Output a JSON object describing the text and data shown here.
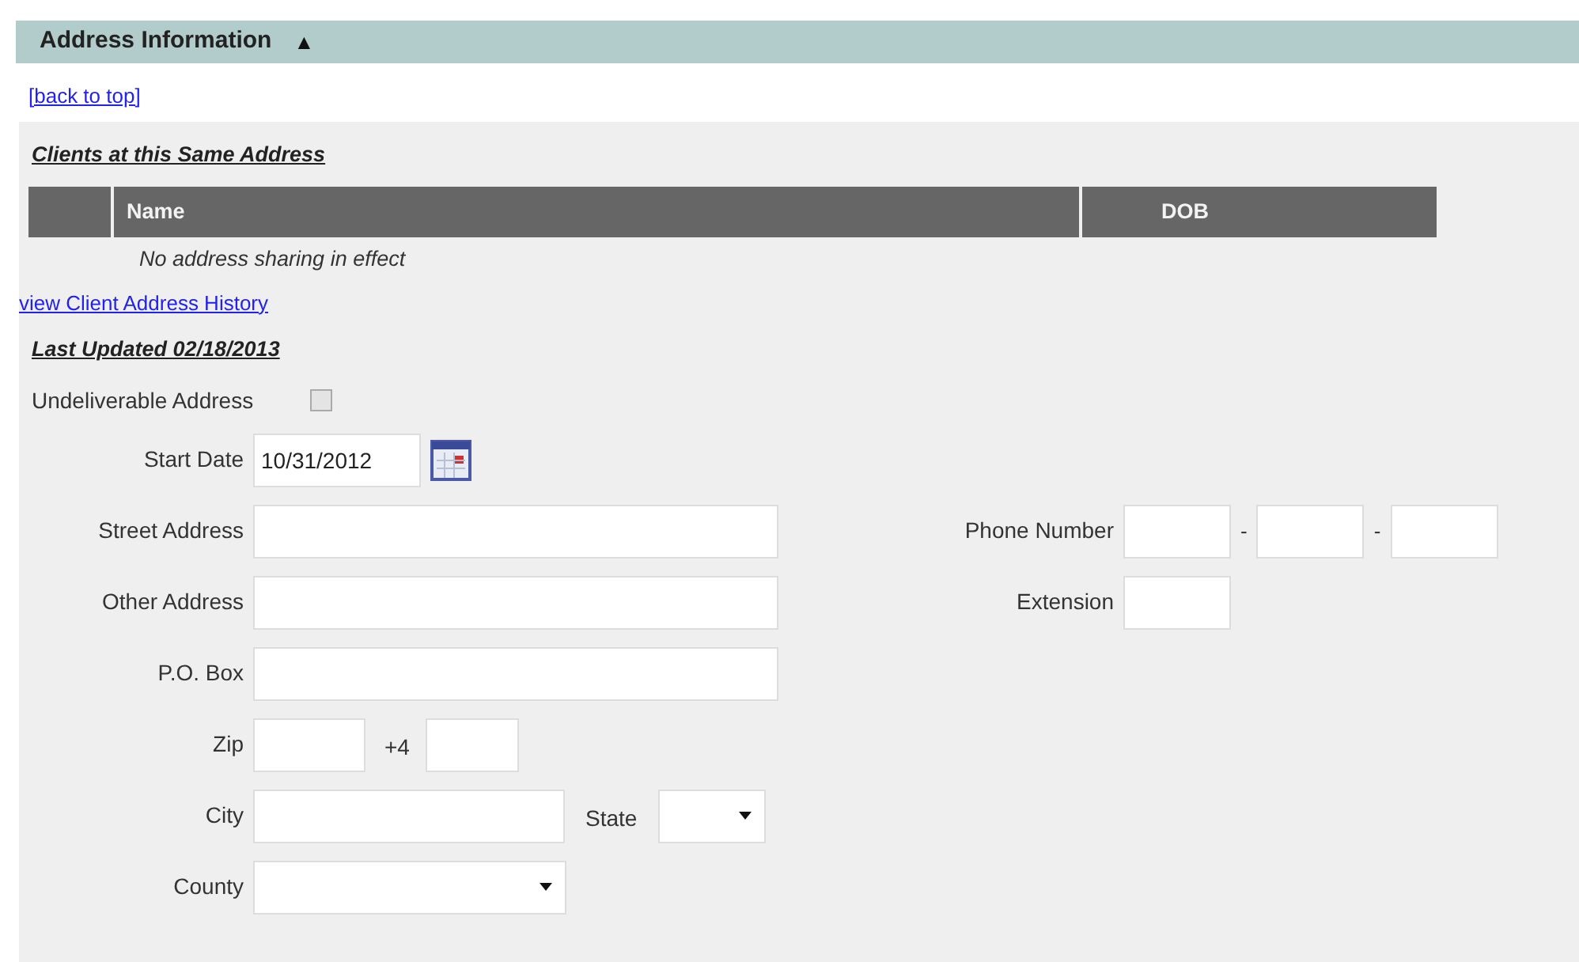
{
  "section": {
    "title": "Address Information",
    "toggle": "▲"
  },
  "back_link": "[back to top]",
  "clients_heading": "Clients at this Same Address",
  "table": {
    "columns": [
      {
        "label": "Name"
      },
      {
        "label": "DOB"
      }
    ],
    "empty_message": "No address sharing in effect"
  },
  "history_link": "view Client Address History",
  "last_updated": "Last Updated 02/18/2013",
  "undeliverable": {
    "label": "Undeliverable Address",
    "checked": false
  },
  "rows": [
    {
      "left": {
        "kind": "date",
        "label": "Start Date",
        "value": "10/31/2012"
      }
    },
    {
      "left": {
        "kind": "text",
        "label": "Street Address"
      },
      "right": {
        "kind": "phone",
        "label": "Phone Number",
        "separators": [
          "-",
          "-"
        ]
      }
    },
    {
      "left": {
        "kind": "text",
        "label": "Other Address"
      },
      "right": {
        "kind": "short",
        "label": "Extension"
      }
    },
    {
      "left": {
        "kind": "text",
        "label": "P.O. Box"
      }
    },
    {
      "left": {
        "kind": "zip",
        "label": "Zip",
        "suffix_label": "+4"
      }
    },
    {
      "left": {
        "kind": "city",
        "label": "City",
        "state_label": "State"
      }
    },
    {
      "left": {
        "kind": "select",
        "label": "County"
      }
    }
  ]
}
